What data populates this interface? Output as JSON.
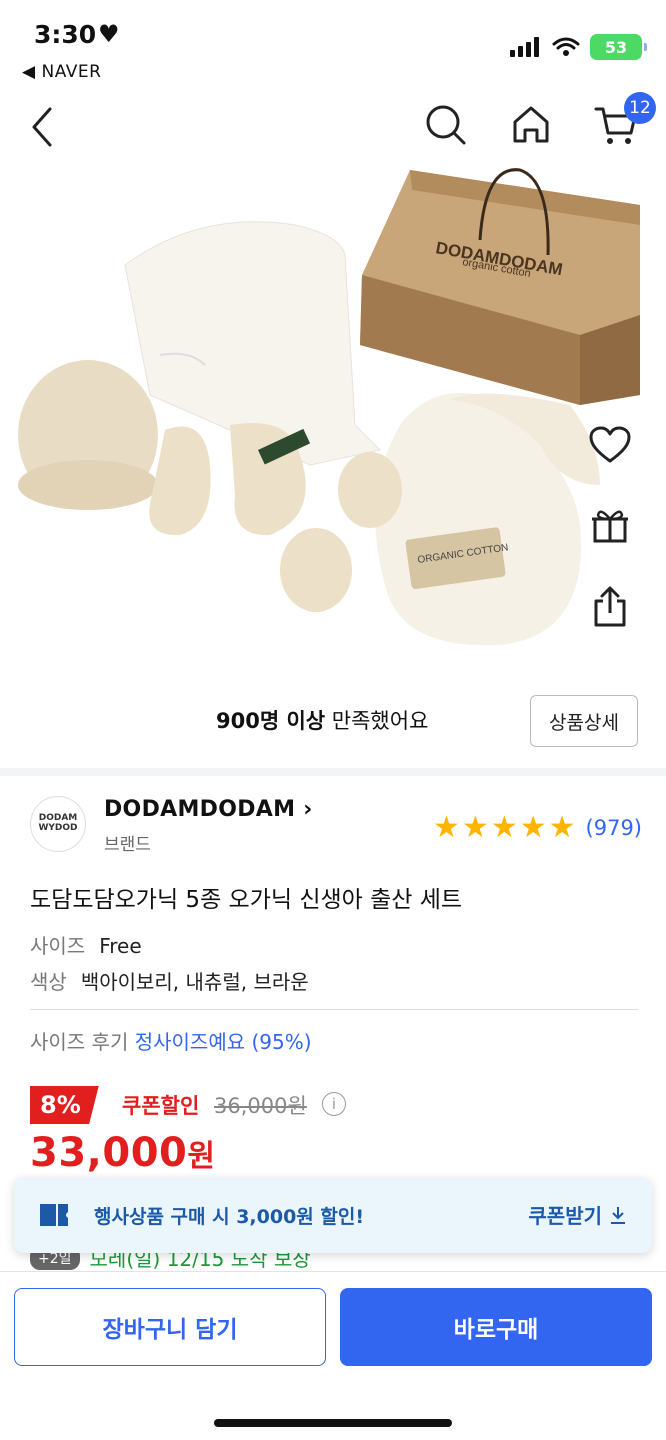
{
  "status_bar": {
    "time": "3:30",
    "back_app": "◀ NAVER",
    "battery": "53"
  },
  "nav": {
    "cart_count": "12"
  },
  "product_image": {
    "box_text": "DODAMDODAM",
    "box_subtext": "organic cotton",
    "tag_text": "ORGANIC COTTON"
  },
  "satisfaction": {
    "bold": "900명 이상",
    "rest": " 만족했어요",
    "detail_button": "상품상세"
  },
  "brand": {
    "name": "DODAMDODAM",
    "sub": "브랜드",
    "logo_text": "DODAM WYDOD"
  },
  "rating": {
    "stars": 5,
    "count": "(979)"
  },
  "product": {
    "title": "도담도담오가닉 5종 오가닉 신생아 출산 세트",
    "options": [
      {
        "key": "사이즈",
        "value": "Free"
      },
      {
        "key": "색상",
        "value": "백아이보리, 내츄럴, 브라운"
      }
    ]
  },
  "review_size": {
    "key": "사이즈 후기 ",
    "value": "정사이즈예요 (95%)"
  },
  "price": {
    "discount": "8%",
    "coupon_label": "쿠폰할인",
    "original": "36,000원",
    "final_number": "33,000",
    "final_unit": "원"
  },
  "coupon_banner": {
    "text": "행사상품 구매 시 3,000원 할인!",
    "button": "쿠폰받기"
  },
  "delivery": {
    "badge": "+2일",
    "text": "모레(일) 12/15 도착 보장"
  },
  "bottom_bar": {
    "cart_button": "장바구니 담기",
    "buy_button": "바로구매"
  },
  "colors": {
    "accent": "#3366f0",
    "sale": "#e11f1f",
    "star": "#ffb400",
    "coupon_text": "#1c5aa8"
  }
}
